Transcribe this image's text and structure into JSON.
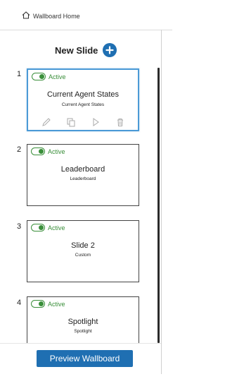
{
  "header": {
    "home_label": "Wallboard Home"
  },
  "panel": {
    "new_slide_label": "New Slide",
    "preview_label": "Preview Wallboard"
  },
  "slides": [
    {
      "number": "1",
      "status": "Active",
      "title": "Current Agent States",
      "subtitle": "Current Agent States",
      "selected": true
    },
    {
      "number": "2",
      "status": "Active",
      "title": "Leaderboard",
      "subtitle": "Leaderboard",
      "selected": false
    },
    {
      "number": "3",
      "status": "Active",
      "title": "Slide 2",
      "subtitle": "Custom",
      "selected": false
    },
    {
      "number": "4",
      "status": "Active",
      "title": "Spotlight",
      "subtitle": "Spotlight",
      "selected": false
    }
  ],
  "colors": {
    "accent": "#1f6fb2",
    "active_green": "#3a8f3a",
    "selected_border": "#4b9ad6"
  },
  "icons": [
    "home-icon",
    "plus-icon",
    "toggle-switch",
    "pencil-icon",
    "copy-icon",
    "play-icon",
    "trash-icon"
  ]
}
